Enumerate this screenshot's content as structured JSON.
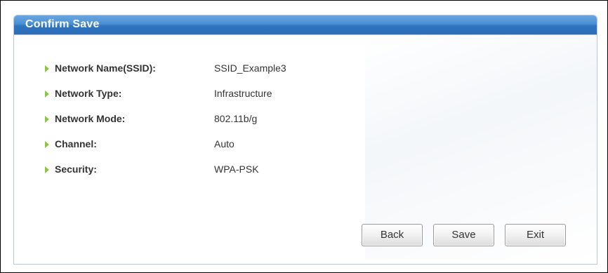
{
  "dialog": {
    "title": "Confirm Save"
  },
  "fields": [
    {
      "label": "Network Name(SSID):",
      "value": "SSID_Example3"
    },
    {
      "label": "Network Type:",
      "value": "Infrastructure"
    },
    {
      "label": "Network Mode:",
      "value": "802.11b/g"
    },
    {
      "label": "Channel:",
      "value": "Auto"
    },
    {
      "label": "Security:",
      "value": "WPA-PSK"
    }
  ],
  "buttons": {
    "back": "Back",
    "save": "Save",
    "exit": "Exit"
  },
  "colors": {
    "header": "#2f74bf",
    "arrow": "#8cc63e",
    "text": "#333333"
  },
  "icons": {
    "bullet": "green-arrow-icon"
  }
}
